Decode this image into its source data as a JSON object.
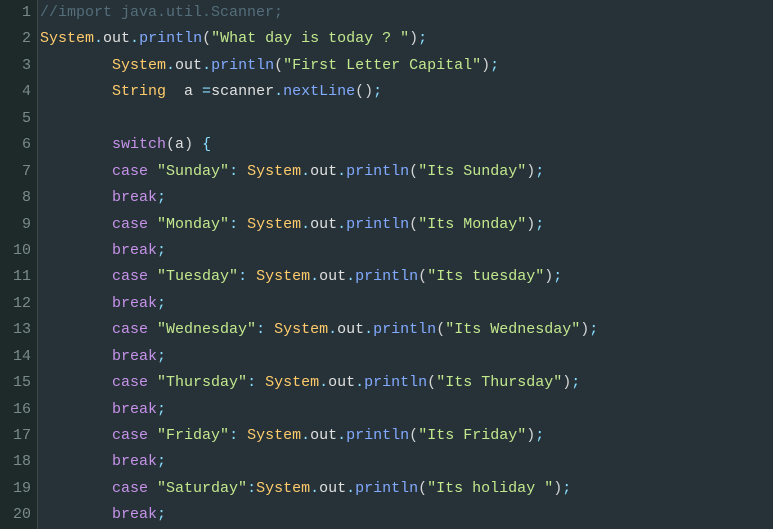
{
  "lines": [
    {
      "n": 1,
      "tokens": [
        [
          "cmt",
          "//import java.util.Scanner;"
        ]
      ]
    },
    {
      "n": 2,
      "tokens": [
        [
          "cls",
          "System"
        ],
        [
          "punc",
          "."
        ],
        [
          "id",
          "out"
        ],
        [
          "punc",
          "."
        ],
        [
          "fn",
          "println"
        ],
        [
          "paren",
          "("
        ],
        [
          "str",
          "\"What day is today ? \""
        ],
        [
          "paren",
          ")"
        ],
        [
          "punc",
          ";"
        ]
      ]
    },
    {
      "n": 3,
      "tokens": [
        [
          "id",
          "        "
        ],
        [
          "cls",
          "System"
        ],
        [
          "punc",
          "."
        ],
        [
          "id",
          "out"
        ],
        [
          "punc",
          "."
        ],
        [
          "fn",
          "println"
        ],
        [
          "paren",
          "("
        ],
        [
          "str",
          "\"First Letter Capital\""
        ],
        [
          "paren",
          ")"
        ],
        [
          "punc",
          ";"
        ]
      ]
    },
    {
      "n": 4,
      "tokens": [
        [
          "id",
          "        "
        ],
        [
          "cls",
          "String"
        ],
        [
          "id",
          "  a "
        ],
        [
          "op",
          "="
        ],
        [
          "id",
          "scanner"
        ],
        [
          "punc",
          "."
        ],
        [
          "fn",
          "nextLine"
        ],
        [
          "paren",
          "()"
        ],
        [
          "punc",
          ";"
        ]
      ]
    },
    {
      "n": 5,
      "tokens": [
        [
          "id",
          ""
        ]
      ]
    },
    {
      "n": 6,
      "tokens": [
        [
          "id",
          "        "
        ],
        [
          "kw",
          "switch"
        ],
        [
          "paren",
          "("
        ],
        [
          "id",
          "a"
        ],
        [
          "paren",
          ")"
        ],
        [
          "id",
          " "
        ],
        [
          "punc",
          "{"
        ]
      ]
    },
    {
      "n": 7,
      "tokens": [
        [
          "id",
          "        "
        ],
        [
          "kw",
          "case"
        ],
        [
          "id",
          " "
        ],
        [
          "str",
          "\"Sunday\""
        ],
        [
          "punc",
          ":"
        ],
        [
          "id",
          " "
        ],
        [
          "cls",
          "System"
        ],
        [
          "punc",
          "."
        ],
        [
          "id",
          "out"
        ],
        [
          "punc",
          "."
        ],
        [
          "fn",
          "println"
        ],
        [
          "paren",
          "("
        ],
        [
          "str",
          "\"Its Sunday\""
        ],
        [
          "paren",
          ")"
        ],
        [
          "punc",
          ";"
        ]
      ]
    },
    {
      "n": 8,
      "tokens": [
        [
          "id",
          "        "
        ],
        [
          "kw",
          "break"
        ],
        [
          "punc",
          ";"
        ]
      ]
    },
    {
      "n": 9,
      "tokens": [
        [
          "id",
          "        "
        ],
        [
          "kw",
          "case"
        ],
        [
          "id",
          " "
        ],
        [
          "str",
          "\"Monday\""
        ],
        [
          "punc",
          ":"
        ],
        [
          "id",
          " "
        ],
        [
          "cls",
          "System"
        ],
        [
          "punc",
          "."
        ],
        [
          "id",
          "out"
        ],
        [
          "punc",
          "."
        ],
        [
          "fn",
          "println"
        ],
        [
          "paren",
          "("
        ],
        [
          "str",
          "\"Its Monday\""
        ],
        [
          "paren",
          ")"
        ],
        [
          "punc",
          ";"
        ]
      ]
    },
    {
      "n": 10,
      "tokens": [
        [
          "id",
          "        "
        ],
        [
          "kw",
          "break"
        ],
        [
          "punc",
          ";"
        ]
      ]
    },
    {
      "n": 11,
      "tokens": [
        [
          "id",
          "        "
        ],
        [
          "kw",
          "case"
        ],
        [
          "id",
          " "
        ],
        [
          "str",
          "\"Tuesday\""
        ],
        [
          "punc",
          ":"
        ],
        [
          "id",
          " "
        ],
        [
          "cls",
          "System"
        ],
        [
          "punc",
          "."
        ],
        [
          "id",
          "out"
        ],
        [
          "punc",
          "."
        ],
        [
          "fn",
          "println"
        ],
        [
          "paren",
          "("
        ],
        [
          "str",
          "\"Its tuesday\""
        ],
        [
          "paren",
          ")"
        ],
        [
          "punc",
          ";"
        ]
      ]
    },
    {
      "n": 12,
      "tokens": [
        [
          "id",
          "        "
        ],
        [
          "kw",
          "break"
        ],
        [
          "punc",
          ";"
        ]
      ]
    },
    {
      "n": 13,
      "tokens": [
        [
          "id",
          "        "
        ],
        [
          "kw",
          "case"
        ],
        [
          "id",
          " "
        ],
        [
          "str",
          "\"Wednesday\""
        ],
        [
          "punc",
          ":"
        ],
        [
          "id",
          " "
        ],
        [
          "cls",
          "System"
        ],
        [
          "punc",
          "."
        ],
        [
          "id",
          "out"
        ],
        [
          "punc",
          "."
        ],
        [
          "fn",
          "println"
        ],
        [
          "paren",
          "("
        ],
        [
          "str",
          "\"Its Wednesday\""
        ],
        [
          "paren",
          ")"
        ],
        [
          "punc",
          ";"
        ]
      ]
    },
    {
      "n": 14,
      "tokens": [
        [
          "id",
          "        "
        ],
        [
          "kw",
          "break"
        ],
        [
          "punc",
          ";"
        ]
      ]
    },
    {
      "n": 15,
      "tokens": [
        [
          "id",
          "        "
        ],
        [
          "kw",
          "case"
        ],
        [
          "id",
          " "
        ],
        [
          "str",
          "\"Thursday\""
        ],
        [
          "punc",
          ":"
        ],
        [
          "id",
          " "
        ],
        [
          "cls",
          "System"
        ],
        [
          "punc",
          "."
        ],
        [
          "id",
          "out"
        ],
        [
          "punc",
          "."
        ],
        [
          "fn",
          "println"
        ],
        [
          "paren",
          "("
        ],
        [
          "str",
          "\"Its Thursday\""
        ],
        [
          "paren",
          ")"
        ],
        [
          "punc",
          ";"
        ]
      ]
    },
    {
      "n": 16,
      "tokens": [
        [
          "id",
          "        "
        ],
        [
          "kw",
          "break"
        ],
        [
          "punc",
          ";"
        ]
      ]
    },
    {
      "n": 17,
      "tokens": [
        [
          "id",
          "        "
        ],
        [
          "kw",
          "case"
        ],
        [
          "id",
          " "
        ],
        [
          "str",
          "\"Friday\""
        ],
        [
          "punc",
          ":"
        ],
        [
          "id",
          " "
        ],
        [
          "cls",
          "System"
        ],
        [
          "punc",
          "."
        ],
        [
          "id",
          "out"
        ],
        [
          "punc",
          "."
        ],
        [
          "fn",
          "println"
        ],
        [
          "paren",
          "("
        ],
        [
          "str",
          "\"Its Friday\""
        ],
        [
          "paren",
          ")"
        ],
        [
          "punc",
          ";"
        ]
      ]
    },
    {
      "n": 18,
      "tokens": [
        [
          "id",
          "        "
        ],
        [
          "kw",
          "break"
        ],
        [
          "punc",
          ";"
        ]
      ]
    },
    {
      "n": 19,
      "tokens": [
        [
          "id",
          "        "
        ],
        [
          "kw",
          "case"
        ],
        [
          "id",
          " "
        ],
        [
          "str",
          "\"Saturday\""
        ],
        [
          "punc",
          ":"
        ],
        [
          "cls",
          "System"
        ],
        [
          "punc",
          "."
        ],
        [
          "id",
          "out"
        ],
        [
          "punc",
          "."
        ],
        [
          "fn",
          "println"
        ],
        [
          "paren",
          "("
        ],
        [
          "str",
          "\"Its holiday \""
        ],
        [
          "paren",
          ")"
        ],
        [
          "punc",
          ";"
        ]
      ]
    },
    {
      "n": 20,
      "tokens": [
        [
          "id",
          "        "
        ],
        [
          "kw",
          "break"
        ],
        [
          "punc",
          ";"
        ]
      ]
    }
  ]
}
